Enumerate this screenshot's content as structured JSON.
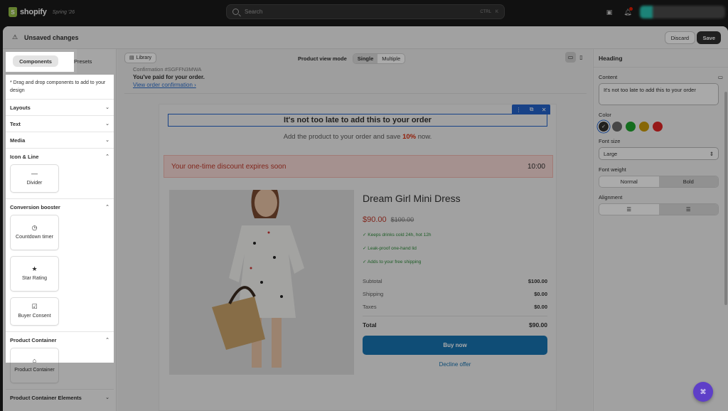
{
  "topbar": {
    "brand": "shopify",
    "edition": "Spring '26",
    "search_placeholder": "Search",
    "shortcut_1": "CTRL",
    "shortcut_2": "K"
  },
  "header": {
    "status": "Unsaved changes",
    "discard_label": "Discard",
    "save_label": "Save"
  },
  "left_panel": {
    "tabs": [
      "Components",
      "Presets"
    ],
    "hint": "* Drag and drop components to add to your design",
    "sections": {
      "layouts": "Layouts",
      "text": "Text",
      "media": "Media",
      "icon_line": "Icon & Line",
      "conversion": "Conversion booster",
      "product_container": "Product Container",
      "product_container_elements": "Product Container Elements"
    },
    "cards": {
      "divider": "Divider",
      "countdown": "Countdown timer",
      "star_rating": "Star Rating",
      "buyer_consent": "Buyer Consent",
      "product_container": "Product Container"
    }
  },
  "canvas": {
    "library_label": "Library",
    "view_mode_label": "Product view mode",
    "view_modes": [
      "Single",
      "Multiple"
    ],
    "confirmation_no": "Confirmation #SGFFN3MWA",
    "paid_text": "You've paid for your order.",
    "view_confirmation": "View order confirmation ›",
    "offer_heading": "It's not too late to add this to your order",
    "subline_pre": "Add the product to your order and save ",
    "subline_pct": "10%",
    "subline_post": " now.",
    "timer_text": "Your one-time discount expires soon",
    "timer_value": "10:00",
    "product_title": "Dream Girl Mini Dress",
    "price": "$90.00",
    "compare_price": "$100.00",
    "features": [
      "✓ Keeps drinks cold 24h, hot 12h",
      "✓ Leak-proof one-hand lid",
      "✓ Adds to your free shipping"
    ],
    "summary": {
      "subtotal_label": "Subtotal",
      "subtotal": "$100.00",
      "shipping_label": "Shipping",
      "shipping": "$0.00",
      "taxes_label": "Taxes",
      "taxes": "$0.00",
      "total_label": "Total",
      "total": "$90.00"
    },
    "buy_label": "Buy now",
    "decline_label": "Decline offer"
  },
  "right_panel": {
    "title": "Heading",
    "content_label": "Content",
    "content_value": "It's not too late to add this to your order",
    "color_label": "Color",
    "colors": [
      "#303030",
      "#6b6b6b",
      "#1fa32d",
      "#c99a0a",
      "#e02424"
    ],
    "font_size_label": "Font size",
    "font_size_value": "Large",
    "font_weight_label": "Font weight",
    "font_weights": [
      "Normal",
      "Bold"
    ],
    "alignment_label": "Alignment"
  }
}
